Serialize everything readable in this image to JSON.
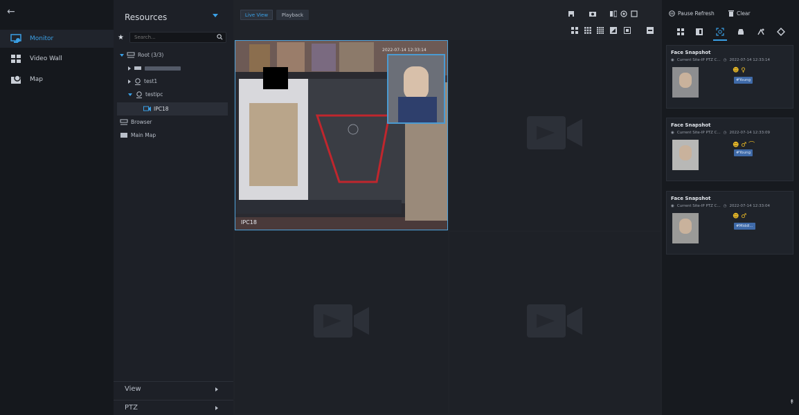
{
  "nav": {
    "items": [
      {
        "label": "Monitor",
        "icon": "monitor-icon",
        "active": true
      },
      {
        "label": "Video Wall",
        "icon": "video-wall-icon",
        "active": false
      },
      {
        "label": "Map",
        "icon": "map-icon",
        "active": false
      }
    ]
  },
  "resources": {
    "title": "Resources",
    "search_placeholder": "Search...",
    "tree": [
      {
        "label": "Root (3/3)"
      },
      {
        "label": ""
      },
      {
        "label": "test1"
      },
      {
        "label": "testipc"
      },
      {
        "label": "IPC18"
      },
      {
        "label": "Browser"
      },
      {
        "label": "Main Map"
      }
    ],
    "bottom": [
      {
        "label": "View"
      },
      {
        "label": "PTZ"
      }
    ]
  },
  "main": {
    "tabs": [
      {
        "label": "Live View",
        "active": true
      },
      {
        "label": "Playback",
        "active": false
      }
    ],
    "video_label": "IPC18",
    "video_timestamp": "2022-07-14 12:33:14"
  },
  "right": {
    "pause_label": "Pause Refresh",
    "clear_label": "Clear",
    "cards": [
      {
        "title": "Face Snapshot",
        "location": "Current Site-IP PTZ C...",
        "time": "2022-07-14 12:33:14",
        "tag": "#Young",
        "icons": "☻ ♀"
      },
      {
        "title": "Face Snapshot",
        "location": "Current Site-IP PTZ C...",
        "time": "2022-07-14 12:33:09",
        "tag": "#Young",
        "icons": "☻ ♂ ⌒"
      },
      {
        "title": "Face Snapshot",
        "location": "Current Site-IP PTZ C...",
        "time": "2022-07-14 12:33:04",
        "tag": "#Middl...",
        "icons": "☻ ♂"
      }
    ]
  },
  "colors": {
    "accent": "#3aa0e6",
    "tag_bg": "#3f6aa8"
  }
}
